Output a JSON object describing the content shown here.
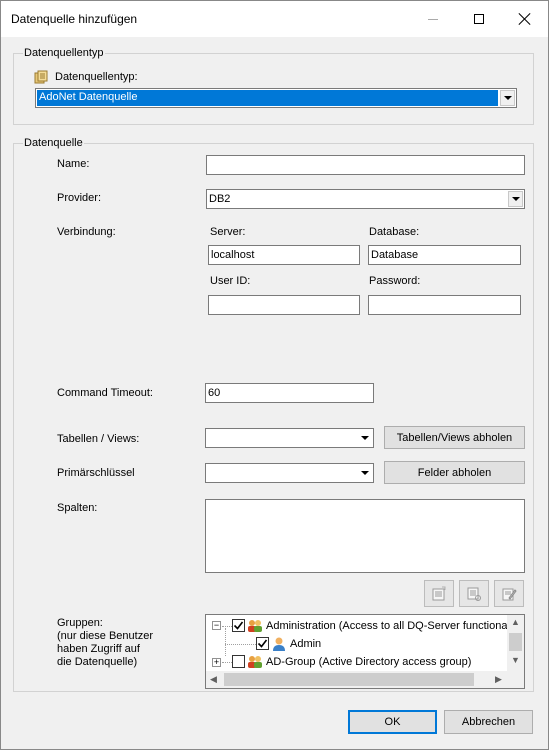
{
  "window": {
    "title": "Datenquelle hinzufügen"
  },
  "type_group": {
    "legend": "Datenquellentyp",
    "label": "Datenquellentyp:",
    "selected": "AdoNet Datenquelle"
  },
  "source_group": {
    "legend": "Datenquelle",
    "name_label": "Name:",
    "name_value": "",
    "provider_label": "Provider:",
    "provider_value": "DB2",
    "connection_label": "Verbindung:",
    "server_label": "Server:",
    "server_value": "localhost",
    "database_label": "Database:",
    "database_value": "Database",
    "userid_label": "User ID:",
    "userid_value": "",
    "password_label": "Password:",
    "password_value": "",
    "timeout_label": "Command Timeout:",
    "timeout_value": "60",
    "tables_label": "Tabellen / Views:",
    "tables_value": "",
    "tables_button": "Tabellen/Views abholen",
    "pk_label": "Primärschlüssel",
    "pk_value": "",
    "fields_button": "Felder abholen",
    "columns_label": "Spalten:",
    "groups_label_1": "Gruppen:",
    "groups_label_2": "(nur diese Benutzer",
    "groups_label_3": "haben Zugriff auf",
    "groups_label_4": "die Datenquelle)",
    "tree": [
      {
        "label": "Administration (Access to all DQ-Server functionali",
        "checked": true,
        "expanded": true,
        "icon": "group-icon"
      },
      {
        "label": "Admin",
        "checked": true,
        "icon": "user-icon"
      },
      {
        "label": "AD-Group (Active Directory access group)",
        "checked": false,
        "expanded": false,
        "icon": "group-icon"
      }
    ]
  },
  "footer": {
    "ok_label": "OK",
    "cancel_label": "Abbrechen"
  },
  "colors": {
    "accent": "#0078d7",
    "dialog_bg": "#f0f0f0"
  }
}
